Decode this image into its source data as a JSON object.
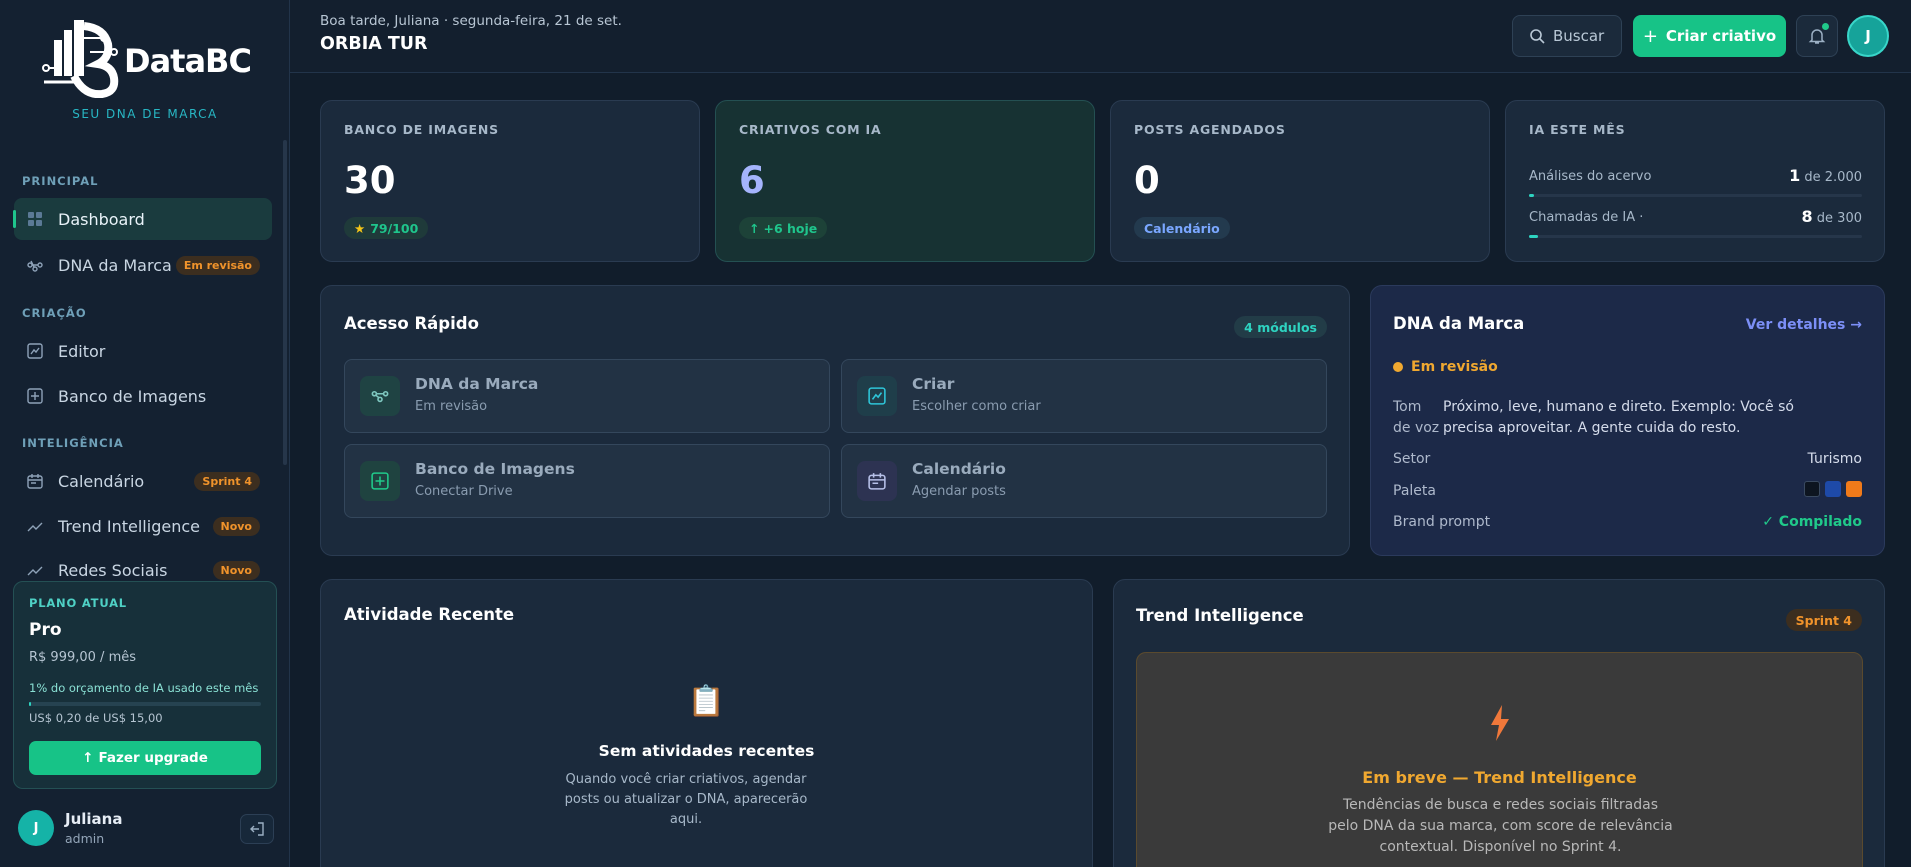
{
  "brand": {
    "name": "DataBC",
    "tagline": "SEU DNA DE MARCA"
  },
  "sidebar": {
    "sections": [
      {
        "title": "PRINCIPAL"
      },
      {
        "title": "CRIAÇÃO"
      },
      {
        "title": "INTELIGÊNCIA"
      }
    ],
    "items": [
      {
        "label": "Dashboard",
        "icon": "dashboard-icon",
        "active": true
      },
      {
        "label": "DNA da Marca",
        "icon": "dna-icon",
        "badge": "Em revisão"
      },
      {
        "label": "Editor",
        "icon": "chart-icon"
      },
      {
        "label": "Banco de Imagens",
        "icon": "plus-square-icon"
      },
      {
        "label": "Calendário",
        "icon": "calendar-icon",
        "badge": "Sprint 4"
      },
      {
        "label": "Trend Intelligence",
        "icon": "trend-icon",
        "badge": "Novo"
      },
      {
        "label": "Redes Sociais",
        "icon": "trend-icon",
        "badge": "Novo"
      }
    ]
  },
  "plan": {
    "label": "PLANO ATUAL",
    "name": "Pro",
    "price": "R$ 999,00 / mês",
    "usage_text": "1% do orçamento de IA usado este mês",
    "usage_fraction": 0.01,
    "spent": "US$ 0,20 de US$ 15,00",
    "upgrade": "Fazer upgrade"
  },
  "user": {
    "initial": "J",
    "name": "Juliana",
    "role": "admin"
  },
  "header": {
    "greeting": "Boa tarde, Juliana · segunda-feira, 21 de set.",
    "org": "ORBIA TUR",
    "search": "Buscar",
    "create": "Criar criativo",
    "avatar": "J"
  },
  "stats": [
    {
      "label": "BANCO DE IMAGENS",
      "value": "30",
      "pill": "79/100",
      "pill_color": "#1fc58c"
    },
    {
      "label": "CRIATIVOS COM IA",
      "value": "6",
      "pill": "+6 hoje",
      "pill_color": "#1fc58c"
    },
    {
      "label": "POSTS AGENDADOS",
      "value": "0",
      "pill": "Calendário",
      "pill_color": "#7aa7ff"
    }
  ],
  "ia_mes": {
    "label": "IA ESTE MÊS",
    "rows": [
      {
        "label": "Análises do acervo",
        "value": "1",
        "total": "de 2.000",
        "fraction": 0.0005
      },
      {
        "label": "Chamadas de IA ·",
        "value": "8",
        "total": "de 300",
        "fraction": 0.027
      }
    ]
  },
  "quick_access": {
    "title": "Acesso Rápido",
    "badge": "4 módulos",
    "items": [
      {
        "title": "DNA da Marca",
        "sub": "Em revisão",
        "icon": "dna-icon"
      },
      {
        "title": "Criar",
        "sub": "Escolher como criar",
        "icon": "chart-icon"
      },
      {
        "title": "Banco de Imagens",
        "sub": "Conectar Drive",
        "icon": "plus-square-icon"
      },
      {
        "title": "Calendário",
        "sub": "Agendar posts",
        "icon": "calendar-icon"
      }
    ]
  },
  "dna_card": {
    "title": "DNA da Marca",
    "link": "Ver detalhes →",
    "status": "Em revisão",
    "tone_label": "Tom de voz",
    "tone_value": "Próximo, leve, humano e direto. Exemplo: Você só precisa aproveitar. A gente cuida do resto.",
    "sector_label": "Setor",
    "sector_value": "Turismo",
    "palette_label": "Paleta",
    "palette": [
      "#0d1520",
      "#1e4aa8",
      "#f07a1a"
    ],
    "prompt_label": "Brand prompt",
    "prompt_value": "✓ Compilado"
  },
  "activity": {
    "title": "Atividade Recente",
    "empty_title": "Sem atividades recentes",
    "empty_text": "Quando você criar criativos, agendar posts ou atualizar o DNA, aparecerão aqui."
  },
  "trend": {
    "title": "Trend Intelligence",
    "badge": "Sprint 4",
    "heading": "Em breve — Trend Intelligence",
    "text": "Tendências de busca e redes sociais filtradas pelo DNA da sua marca, com score de relevância contextual. Disponível no Sprint 4."
  }
}
